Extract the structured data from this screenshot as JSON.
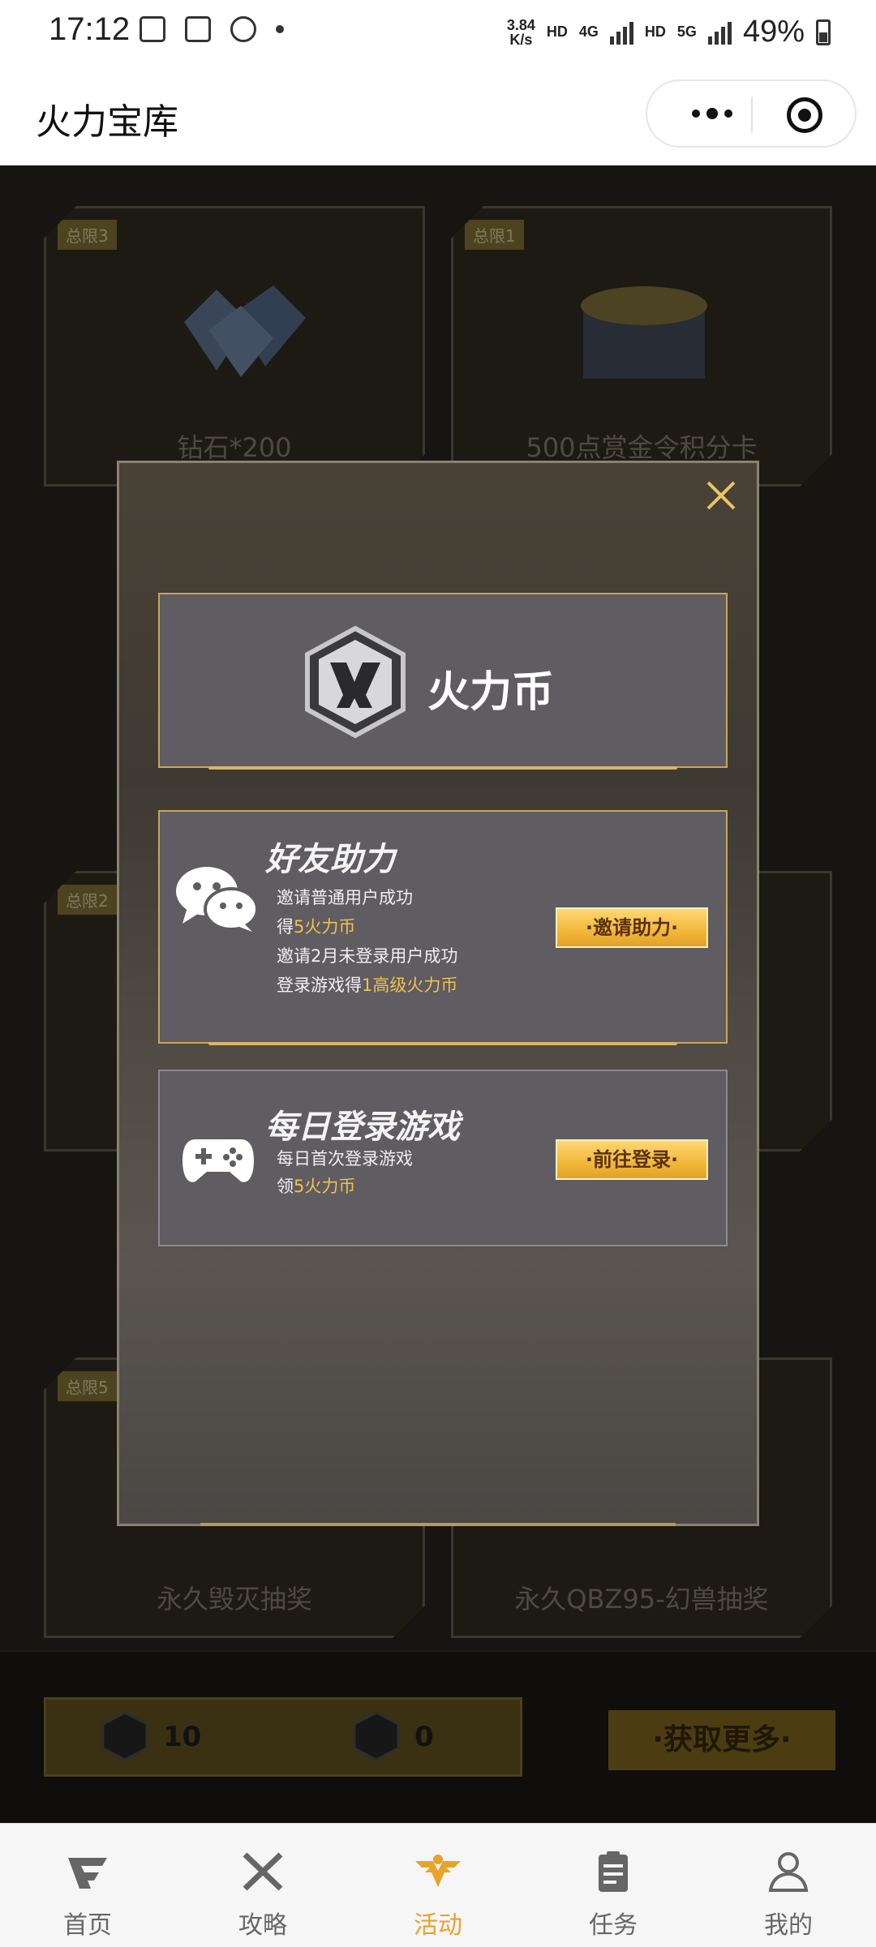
{
  "status_bar": {
    "time": "17:12",
    "speed": "3.84\nK/s",
    "hd1": "HD",
    "net1": "4G",
    "hd2": "HD",
    "net2": "5G",
    "battery": "49%"
  },
  "title_bar": {
    "title": "火力宝库"
  },
  "background": {
    "cards": [
      {
        "badge": "总限3",
        "label": "钻石*200"
      },
      {
        "badge": "总限1",
        "label": "500点赏金令积分卡"
      },
      {
        "badge": "总限2",
        "label": ""
      },
      {
        "badge": "总限5",
        "label": "永久毁灭抽奖"
      },
      {
        "badge": "",
        "label": "永久QBZ95-幻兽抽奖"
      }
    ],
    "coin_balance_1": "10",
    "coin_balance_2": "0",
    "get_more_label": "·获取更多·"
  },
  "modal": {
    "header_title": "火力币",
    "friend": {
      "title": "好友助力",
      "line1": "邀请普通用户成功",
      "line2_prefix": "得",
      "line2_highlight": "5火力币",
      "line3": "邀请2月未登录用户成功",
      "line4_prefix": "登录游戏得",
      "line4_highlight": "1高级火力币",
      "button": "·邀请助力·"
    },
    "daily": {
      "title": "每日登录游戏",
      "line1": "每日首次登录游戏",
      "line2_prefix": "领",
      "line2_highlight": "5火力币",
      "button": "·前往登录·"
    }
  },
  "tabs": [
    {
      "label": "首页",
      "icon": "cf-logo-icon"
    },
    {
      "label": "攻略",
      "icon": "crossed-guns-icon"
    },
    {
      "label": "活动",
      "icon": "eagle-wings-icon",
      "active": true
    },
    {
      "label": "任务",
      "icon": "clipboard-icon"
    },
    {
      "label": "我的",
      "icon": "user-icon"
    }
  ],
  "colors": {
    "accent_gold": "#f1c24b",
    "active_tab": "#e8a32a"
  }
}
